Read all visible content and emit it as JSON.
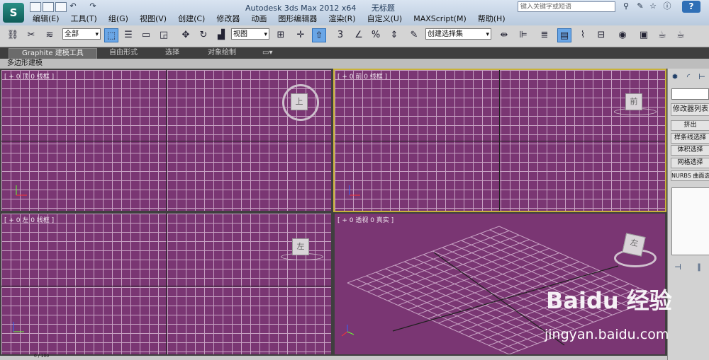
{
  "title": {
    "app": "Autodesk 3ds Max  2012 x64",
    "doc": "无标题"
  },
  "menu": [
    "编辑(E)",
    "工具(T)",
    "组(G)",
    "视图(V)",
    "创建(C)",
    "修改器",
    "动画",
    "图形编辑器",
    "渲染(R)",
    "自定义(U)",
    "MAXScript(M)",
    "帮助(H)"
  ],
  "search": {
    "placeholder": "键入关键字或短语"
  },
  "help_label": "?",
  "toolbar": {
    "selection_filter": "全部",
    "ref_coord": "视图",
    "named_selection": "创建选择集",
    "snap_label": "3"
  },
  "ribbon": {
    "tabs": [
      "Graphite 建模工具",
      "自由形式",
      "选择",
      "对象绘制"
    ],
    "subpanel": "多边形建模"
  },
  "viewports": {
    "top": {
      "label": "[ + 0 顶 0 线框 ]",
      "cube": "上"
    },
    "front": {
      "label": "[ + 0 前 0 线框 ]",
      "cube": "前"
    },
    "left": {
      "label": "[ + 0 左 0 线框 ]",
      "cube": "左"
    },
    "persp": {
      "label": "[ + 0 透视 0 真实 ]",
      "cube": "左"
    }
  },
  "command_panel": {
    "modifier_list": "修改器列表",
    "buttons": [
      "挤出",
      "样条线选择",
      "体积选择",
      "网格选择",
      "NURBS 曲面选择"
    ]
  },
  "status": {
    "frame": "0 / 100"
  },
  "watermark": {
    "brand": "Baidu 经验",
    "url": "jingyan.baidu.com"
  },
  "colors": {
    "viewport_bg": "#7a3673",
    "grid": "#c8a2c4",
    "active_border": "#c9b23a"
  }
}
